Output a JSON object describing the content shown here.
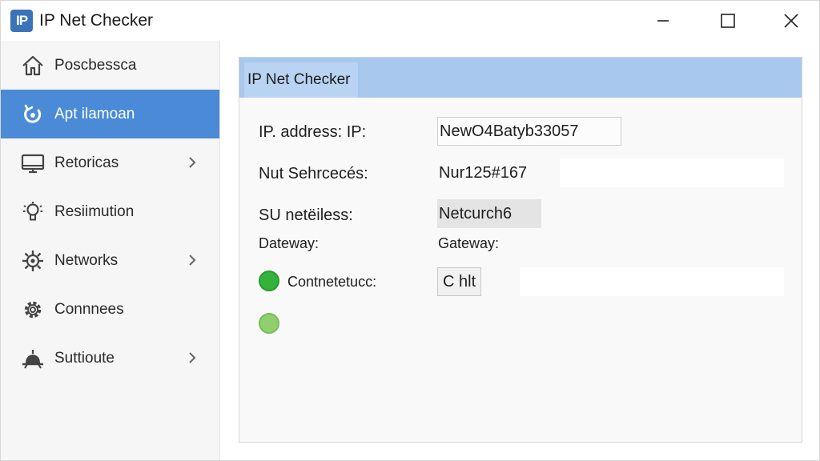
{
  "window": {
    "app_logo_text": "IP",
    "title": "IP Net Checker"
  },
  "sidebar": {
    "items": [
      {
        "label": "Poscbessca",
        "icon": "home-icon",
        "active": false,
        "has_chevron": false
      },
      {
        "label": "Apt ilamoan",
        "icon": "refresh-icon",
        "active": true,
        "has_chevron": false
      },
      {
        "label": "Retoricas",
        "icon": "monitor-icon",
        "active": false,
        "has_chevron": true
      },
      {
        "label": "Resiimution",
        "icon": "lightbulb-icon",
        "active": false,
        "has_chevron": false
      },
      {
        "label": "Networks",
        "icon": "network-gear-icon",
        "active": false,
        "has_chevron": true
      },
      {
        "label": "Connnees",
        "icon": "gear-icon",
        "active": false,
        "has_chevron": false
      },
      {
        "label": "Suttioute",
        "icon": "bell-icon",
        "active": false,
        "has_chevron": true
      }
    ]
  },
  "panel": {
    "tab_title": "IP Net Checker",
    "ip_label": "IP. address: IP:",
    "ip_value": "NewO4Batyb33057",
    "nut_label": "Nut Sehrcecés:",
    "nut_value": "Nur125#167",
    "su_label": "SU netëiless:",
    "su_value": "Netcurch6",
    "dateway_label": "Dateway:",
    "gateway_value": "Gateway:",
    "status_label": "Contnetetucc:",
    "check_button": "C hlt"
  },
  "colors": {
    "accent": "#4a8ad6",
    "panel_header": "#a8c8ee",
    "status_green": "#33b23c",
    "status_light_green": "#8fcf6e"
  }
}
